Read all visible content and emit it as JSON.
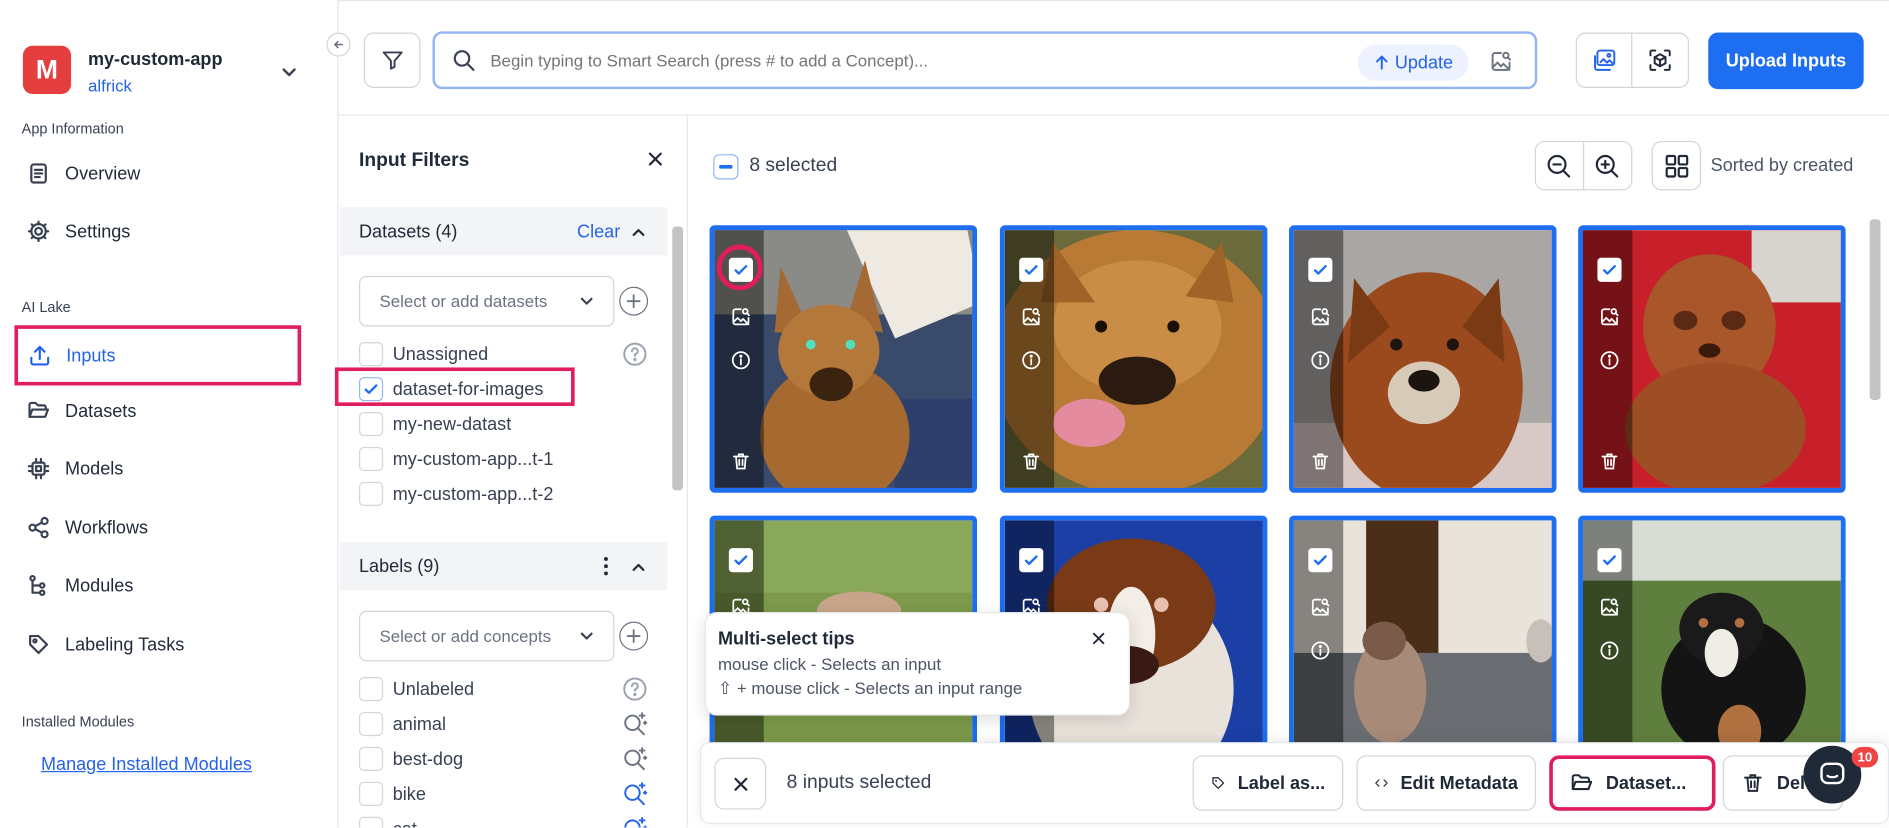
{
  "app": {
    "initial": "M",
    "name": "my-custom-app",
    "user": "alfrick"
  },
  "sidebar": {
    "sec_app_info": "App Information",
    "overview": "Overview",
    "settings": "Settings",
    "sec_ai_lake": "AI Lake",
    "inputs": "Inputs",
    "datasets": "Datasets",
    "models": "Models",
    "workflows": "Workflows",
    "modules": "Modules",
    "labeling_tasks": "Labeling Tasks",
    "sec_installed": "Installed Modules",
    "manage_link": "Manage Installed Modules"
  },
  "search": {
    "placeholder": "Begin typing to Smart Search (press # to add a Concept)...",
    "update_label": "Update"
  },
  "upload_label": "Upload Inputs",
  "filters": {
    "title": "Input Filters",
    "datasets_header": "Datasets (4)",
    "clear_label": "Clear",
    "datasets_placeholder": "Select or add datasets",
    "dataset_items": [
      "Unassigned",
      "dataset-for-images",
      "my-new-datast",
      "my-custom-app...t-1",
      "my-custom-app...t-2"
    ],
    "labels_header": "Labels (9)",
    "concepts_placeholder": "Select or add concepts",
    "label_items": [
      "Unlabeled",
      "animal",
      "best-dog",
      "bike",
      "cat"
    ]
  },
  "gallery": {
    "selected_text": "8 selected",
    "sort_text": "Sorted by created"
  },
  "tooltip": {
    "title": "Multi-select tips",
    "line1": "mouse click - Selects an input",
    "line2": "⇧ + mouse click - Selects an input range"
  },
  "action_bar": {
    "count_text": "8 inputs selected",
    "label_btn": "Label as...",
    "metadata_btn": "Edit Metadata",
    "dataset_btn": "Dataset...",
    "delete_btn": "Delete"
  },
  "chat_badge": "10",
  "colors": {
    "accent": "#1d6ef0",
    "highlight": "#e11d5c",
    "brand": "#e53e3e"
  }
}
